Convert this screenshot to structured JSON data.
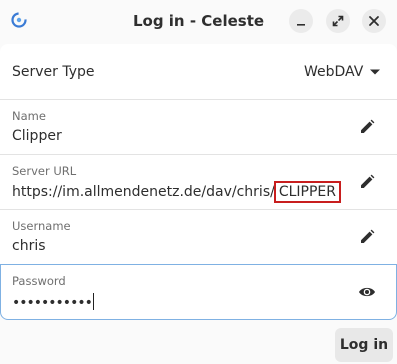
{
  "window": {
    "title": "Log in - Celeste",
    "accent_color": "#3584e4"
  },
  "form": {
    "server_type": {
      "label": "Server Type",
      "value": "WebDAV"
    },
    "name": {
      "label": "Name",
      "value": "Clipper"
    },
    "server_url": {
      "label": "Server URL",
      "value_prefix": "https://im.allmendenetz.de/dav/chris/",
      "value_highlighted": "CLIPPER"
    },
    "username": {
      "label": "Username",
      "value": "chris"
    },
    "password": {
      "label": "Password",
      "value": "•••••••••••"
    }
  },
  "actions": {
    "login_label": "Log in"
  },
  "icons": {
    "app": "celeste-app-icon",
    "minimize": "minimize-icon",
    "maximize": "maximize-icon",
    "close": "close-icon",
    "dropdown": "chevron-down-icon",
    "edit": "pencil-icon",
    "reveal": "eye-icon"
  }
}
